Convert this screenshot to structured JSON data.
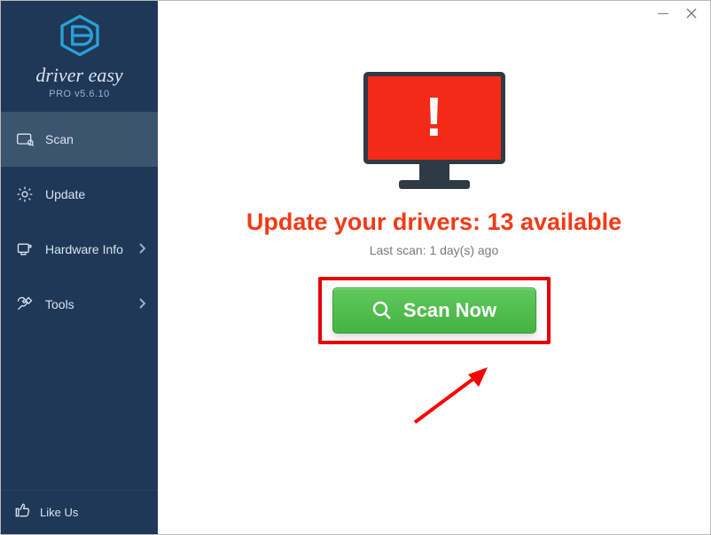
{
  "brand": {
    "name": "driver easy",
    "sub": "PRO v5.6.10"
  },
  "sidebar": {
    "items": [
      {
        "label": "Scan",
        "active": true,
        "hasChevron": false,
        "icon": "scan"
      },
      {
        "label": "Update",
        "active": false,
        "hasChevron": false,
        "icon": "update"
      },
      {
        "label": "Hardware Info",
        "active": false,
        "hasChevron": true,
        "icon": "hardware"
      },
      {
        "label": "Tools",
        "active": false,
        "hasChevron": true,
        "icon": "tools"
      }
    ],
    "footer": {
      "like_label": "Like Us"
    }
  },
  "main": {
    "headline": "Update your drivers: 13 available",
    "subline": "Last scan: 1 day(s) ago",
    "cta_label": "Scan Now"
  },
  "accent": {
    "alert": "#f32a18",
    "cta": "#47b545"
  }
}
